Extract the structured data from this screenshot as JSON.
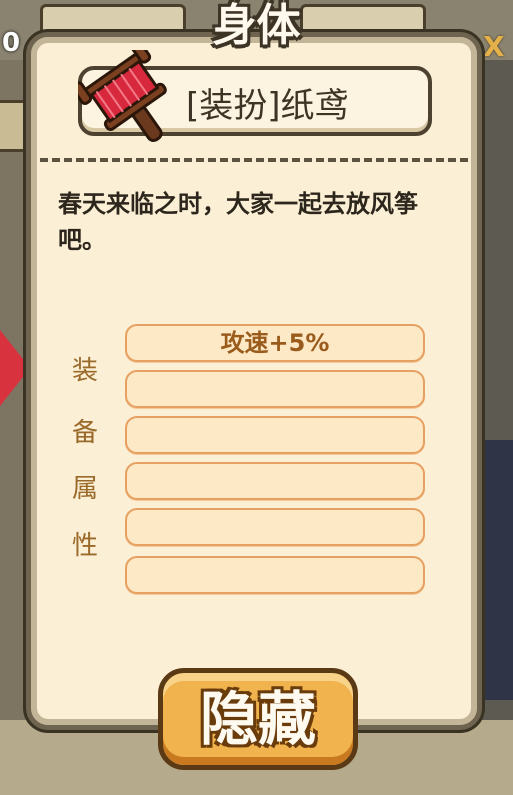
{
  "background": {
    "left_number": "0",
    "right_close": "X"
  },
  "panel": {
    "title": "身体",
    "item_name": "[装扮]纸鸢",
    "item_icon": "kite-spool-icon",
    "description": "春天来临之时，大家一起去放风筝吧。",
    "attributes_label": [
      "装",
      "备",
      "属",
      "性"
    ],
    "attribute_slots": [
      "攻速+5%",
      "",
      "",
      "",
      "",
      ""
    ],
    "hide_button": "隐藏"
  },
  "colors": {
    "panel_bg": "#fbefd5",
    "panel_border": "#6e6450",
    "slot_bg": "#fde9c5",
    "slot_border": "#e6a062",
    "attr_text": "#9a5c1c",
    "button_bg": "#f0b34d"
  }
}
